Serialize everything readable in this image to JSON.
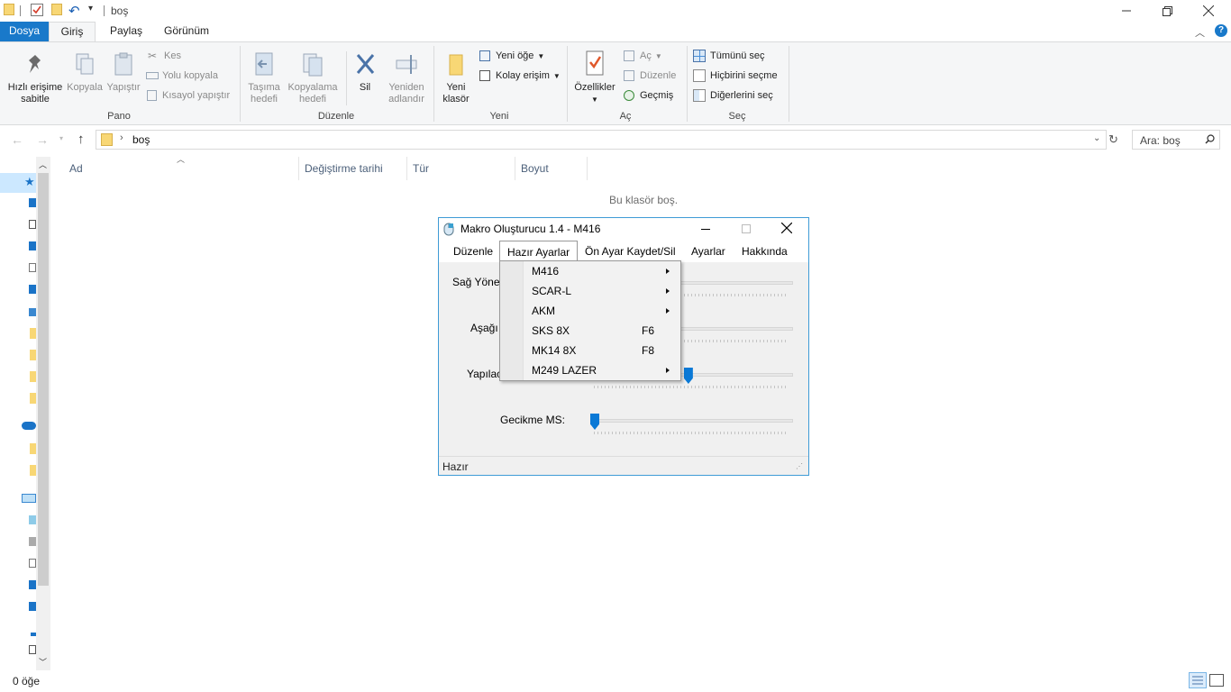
{
  "explorer": {
    "title": "boş",
    "tabs": {
      "file": "Dosya",
      "home": "Giriş",
      "share": "Paylaş",
      "view": "Görünüm"
    },
    "ribbon": {
      "pano": {
        "pin": "Hızlı erişime\nsabitle",
        "copy": "Kopyala",
        "paste": "Yapıştır",
        "cut": "Kes",
        "copy_path": "Yolu kopyala",
        "paste_shortcut": "Kısayol yapıştır",
        "label": "Pano"
      },
      "organize": {
        "move_to": "Taşıma\nhedefi",
        "copy_to": "Kopyalama\nhedefi",
        "delete": "Sil",
        "rename": "Yeniden\nadlandır",
        "label": "Düzenle"
      },
      "new": {
        "new_folder": "Yeni\nklasör",
        "new_item": "Yeni öğe",
        "easy_access": "Kolay erişim",
        "label": "Yeni"
      },
      "open": {
        "properties": "Özellikler",
        "open": "Aç",
        "edit": "Düzenle",
        "history": "Geçmiş",
        "label": "Aç"
      },
      "select": {
        "select_all": "Tümünü seç",
        "select_none": "Hiçbirini seçme",
        "invert": "Diğerlerini seç",
        "label": "Seç"
      }
    },
    "address": {
      "crumb": "boş",
      "search_placeholder": "Ara: boş"
    },
    "columns": {
      "name": "Ad",
      "date": "Değiştirme tarihi",
      "type": "Tür",
      "size": "Boyut"
    },
    "empty_message": "Bu klasör boş.",
    "status": "0 öğe"
  },
  "dialog": {
    "title": "Makro Oluşturucu 1.4 - M416",
    "menu": [
      "Düzenle",
      "Hazır Ayarlar",
      "Ön Ayar Kaydet/Sil",
      "Ayarlar",
      "Hakkında"
    ],
    "labels": {
      "right": "Sağ Yöne",
      "down": "Aşağı",
      "done": "Yapılac",
      "delay": "Gecikme MS:"
    },
    "sliders": {
      "third_value_fraction": 0.47,
      "delay_value_fraction": 0.0
    },
    "status": "Hazır",
    "dropdown": [
      {
        "label": "M416",
        "shortcut": "",
        "submenu": true
      },
      {
        "label": "SCAR-L",
        "shortcut": "",
        "submenu": true
      },
      {
        "label": "AKM",
        "shortcut": "",
        "submenu": true
      },
      {
        "label": "SKS 8X",
        "shortcut": "F6",
        "submenu": false
      },
      {
        "label": "MK14 8X",
        "shortcut": "F8",
        "submenu": false
      },
      {
        "label": "M249 LAZER",
        "shortcut": "",
        "submenu": true
      }
    ]
  }
}
